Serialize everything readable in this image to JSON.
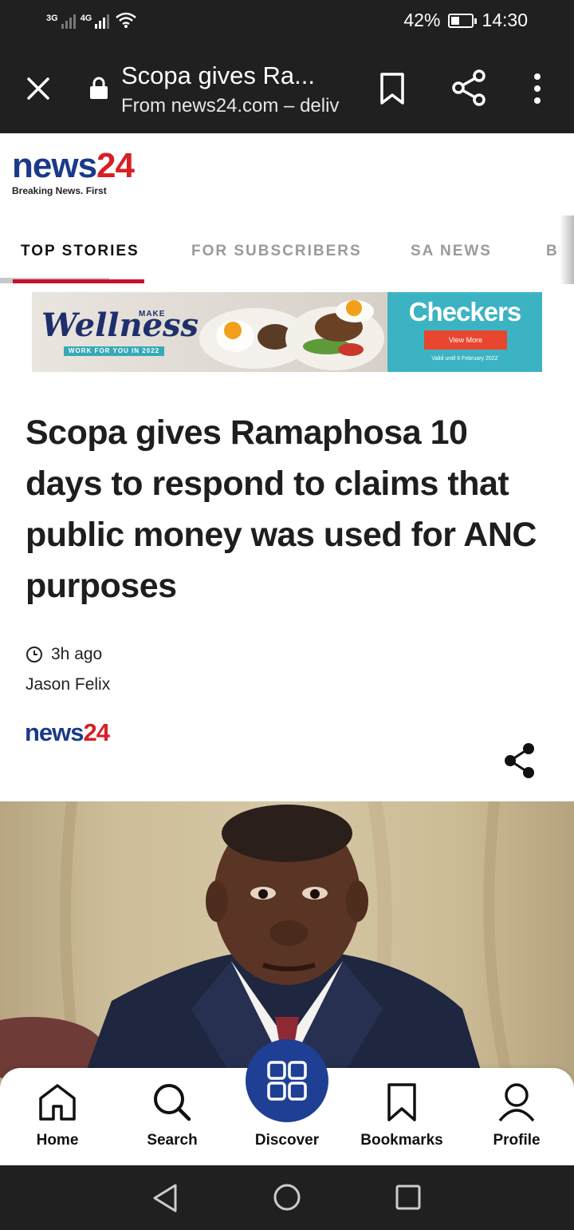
{
  "status_bar": {
    "network1": "3G",
    "network2": "4G",
    "battery_percent": "42%",
    "battery_level": 0.42,
    "time": "14:30"
  },
  "browser": {
    "title": "Scopa gives Ra...",
    "subtitle": "From news24.com – deliv",
    "icons": [
      "close-icon",
      "lock-icon",
      "bookmark-icon",
      "share-icon",
      "more-vertical-icon"
    ]
  },
  "site": {
    "logo_news": "news",
    "logo_24": "24",
    "tagline": "Breaking News. First"
  },
  "tabs": [
    {
      "label": "TOP STORIES",
      "active": true
    },
    {
      "label": "FOR SUBSCRIBERS",
      "active": false
    },
    {
      "label": "SA NEWS",
      "active": false
    },
    {
      "label": "BU",
      "active": false
    }
  ],
  "ad": {
    "script_text": "Wellness",
    "make_text": "MAKE",
    "strap_text": "WORK FOR YOU IN 2022",
    "brand": "Checkers",
    "button": "View More",
    "validity": "Valid until 6 February 2022"
  },
  "article": {
    "headline": "Scopa gives Ramaphosa 10 days to respond to claims that public money was used for ANC purposes",
    "time": "3h ago",
    "author": "Jason Felix",
    "source_news": "news",
    "source_24": "24"
  },
  "bottom_nav": [
    {
      "label": "Home",
      "icon": "home-icon"
    },
    {
      "label": "Search",
      "icon": "search-icon"
    },
    {
      "label": "Discover",
      "icon": "grid-icon"
    },
    {
      "label": "Bookmarks",
      "icon": "bookmark-icon"
    },
    {
      "label": "Profile",
      "icon": "user-icon"
    }
  ],
  "colors": {
    "brand_blue": "#1a3a8a",
    "brand_red": "#d71f26",
    "tab_underline": "#c8102e",
    "discover_button": "#1f3f94",
    "checkers_teal": "#3cb3c3"
  }
}
